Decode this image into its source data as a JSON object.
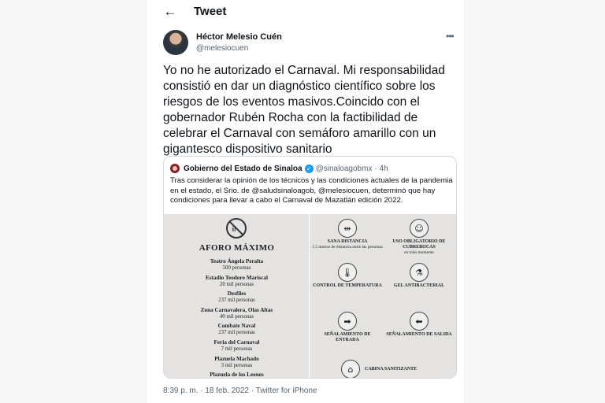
{
  "header": {
    "title": "Tweet",
    "back_icon": "arrow-left-icon"
  },
  "tweet": {
    "author_name": "Héctor Melesio Cuén",
    "author_handle": "@melesiocuen",
    "more_icon": "more-horizontal-icon",
    "text": "Yo no he autorizado el Carnaval. Mi responsabilidad consistió en dar un diagnóstico científico sobre los riesgos de los eventos masivos.Coincido con el gobernador Rubén Rocha con la factibilidad de celebrar el Carnaval con semáforo amarillo con un gigantesco dispositivo sanitario",
    "footer": "8:39 p. m. · 18 feb. 2022 · Twitter for iPhone"
  },
  "quote": {
    "name": "Gobierno del Estado de Sinaloa",
    "verified": "✓",
    "handle": "@sinaloagobmx",
    "time": "· 4h",
    "text": "Tras considerar la opinión de los técnicos y las condiciones actuales de la pandemia en el estado, el Srio. de @saludsinaloagob, @melesiocuen, determinó que hay condiciones para llevar a cabo el Carnaval de Mazatlán edición 2022.",
    "infographic": {
      "title": "AFORO MÁXIMO",
      "venues": [
        {
          "name": "Teatro Ángela Peralta",
          "count": "500 personas"
        },
        {
          "name": "Estadio Teodoro Mariscal",
          "count": "20 mil personas"
        },
        {
          "name": "Desfiles",
          "count": "237 mil personas"
        },
        {
          "name": "Zona Carnavalera, Olas Altas",
          "count": "40 mil personas"
        },
        {
          "name": "Combate Naval",
          "count": "237 mil personas"
        },
        {
          "name": "Feria del Carnaval",
          "count": "7 mil personas"
        },
        {
          "name": "Plazuela Machado",
          "count": "3 mil personas"
        },
        {
          "name": "Plazuela de los Leones",
          "count": ""
        }
      ],
      "measures": [
        {
          "title": "SANA DISTANCIA",
          "sub": "1.5 metros de distancia entre las personas",
          "icon": "people-distance-icon",
          "glyph": "⇹"
        },
        {
          "title": "USO OBLIGATORIO DE CUBREBOCAS",
          "sub": "en todo momento",
          "icon": "face-mask-icon",
          "glyph": "☺"
        },
        {
          "title": "CONTROL DE TEMPERATURA",
          "sub": "",
          "icon": "thermometer-icon",
          "glyph": "🌡"
        },
        {
          "title": "GEL ANTIBACTERIAL",
          "sub": "",
          "icon": "gel-bottle-icon",
          "glyph": "⚗"
        },
        {
          "title": "SEÑALAMIENTO DE ENTRADA",
          "sub": "",
          "icon": "arrow-right-icon",
          "glyph": "➡"
        },
        {
          "title": "SEÑALAMIENTO DE SALIDA",
          "sub": "",
          "icon": "arrow-left-icon",
          "glyph": "⬅"
        },
        {
          "title": "CABINA SANITIZANTE",
          "sub": "",
          "icon": "sanitizing-booth-icon",
          "glyph": "⌂"
        }
      ]
    }
  },
  "colors": {
    "accent": "#1d9bf0",
    "text": "#0f1419",
    "muted": "#536471",
    "infographic_bg": "#e4e3e1"
  }
}
